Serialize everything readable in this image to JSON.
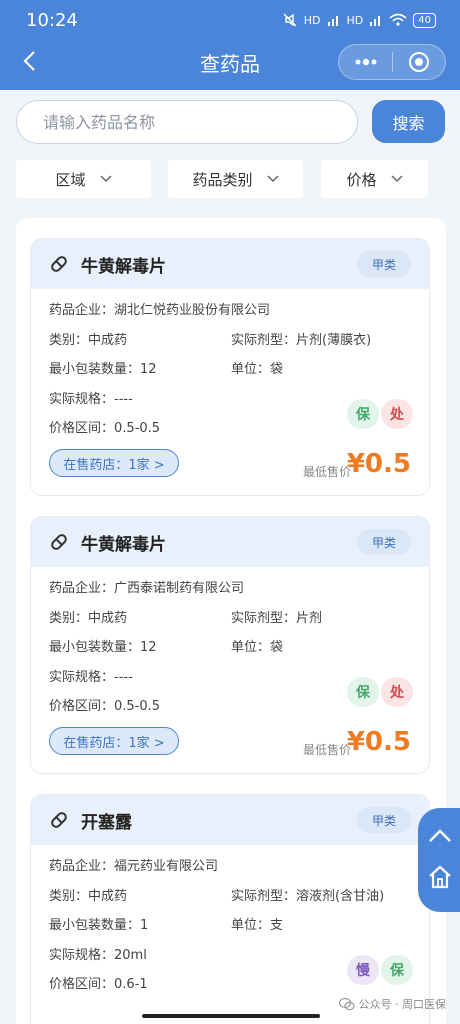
{
  "status_bar": {
    "time": "10:24",
    "net1": "HD",
    "net2": "HD",
    "battery": "40"
  },
  "nav": {
    "title": "查药品"
  },
  "search": {
    "placeholder": "请输入药品名称",
    "button": "搜索"
  },
  "filters": [
    {
      "label": "区域"
    },
    {
      "label": "药品类别"
    },
    {
      "label": "价格"
    }
  ],
  "labels": {
    "company": "药品企业：",
    "category": "类别：",
    "dosage": "实际剂型：",
    "min_pack": "最小包装数量：",
    "unit": "单位：",
    "spec": "实际规格：",
    "price_range": "价格区间：",
    "lowest": "最低售价"
  },
  "cards": [
    {
      "name": "牛黄解毒片",
      "tag": "甲类",
      "company": "湖北仁悦药业股份有限公司",
      "category": "中成药",
      "dosage": "片剂(薄膜衣)",
      "min_pack": "12",
      "unit": "袋",
      "spec": "----",
      "price_range": "0.5-0.5",
      "badges": [
        "保",
        "处"
      ],
      "stores": "在售药店：1家 >",
      "price": "¥0.5"
    },
    {
      "name": "牛黄解毒片",
      "tag": "甲类",
      "company": "广西泰诺制药有限公司",
      "category": "中成药",
      "dosage": "片剂",
      "min_pack": "12",
      "unit": "袋",
      "spec": "----",
      "price_range": "0.5-0.5",
      "badges": [
        "保",
        "处"
      ],
      "stores": "在售药店：1家 >",
      "price": "¥0.5"
    },
    {
      "name": "开塞露",
      "tag": "甲类",
      "company": "福元药业有限公司",
      "category": "中成药",
      "dosage": "溶液剂(含甘油)",
      "min_pack": "1",
      "unit": "支",
      "spec": "20ml",
      "price_range": "0.6-1",
      "badges": [
        "慢",
        "保"
      ]
    }
  ],
  "watermark": "公众号 · 周口医保",
  "colors": {
    "primary": "#4a85d9",
    "price": "#ee7a21"
  }
}
